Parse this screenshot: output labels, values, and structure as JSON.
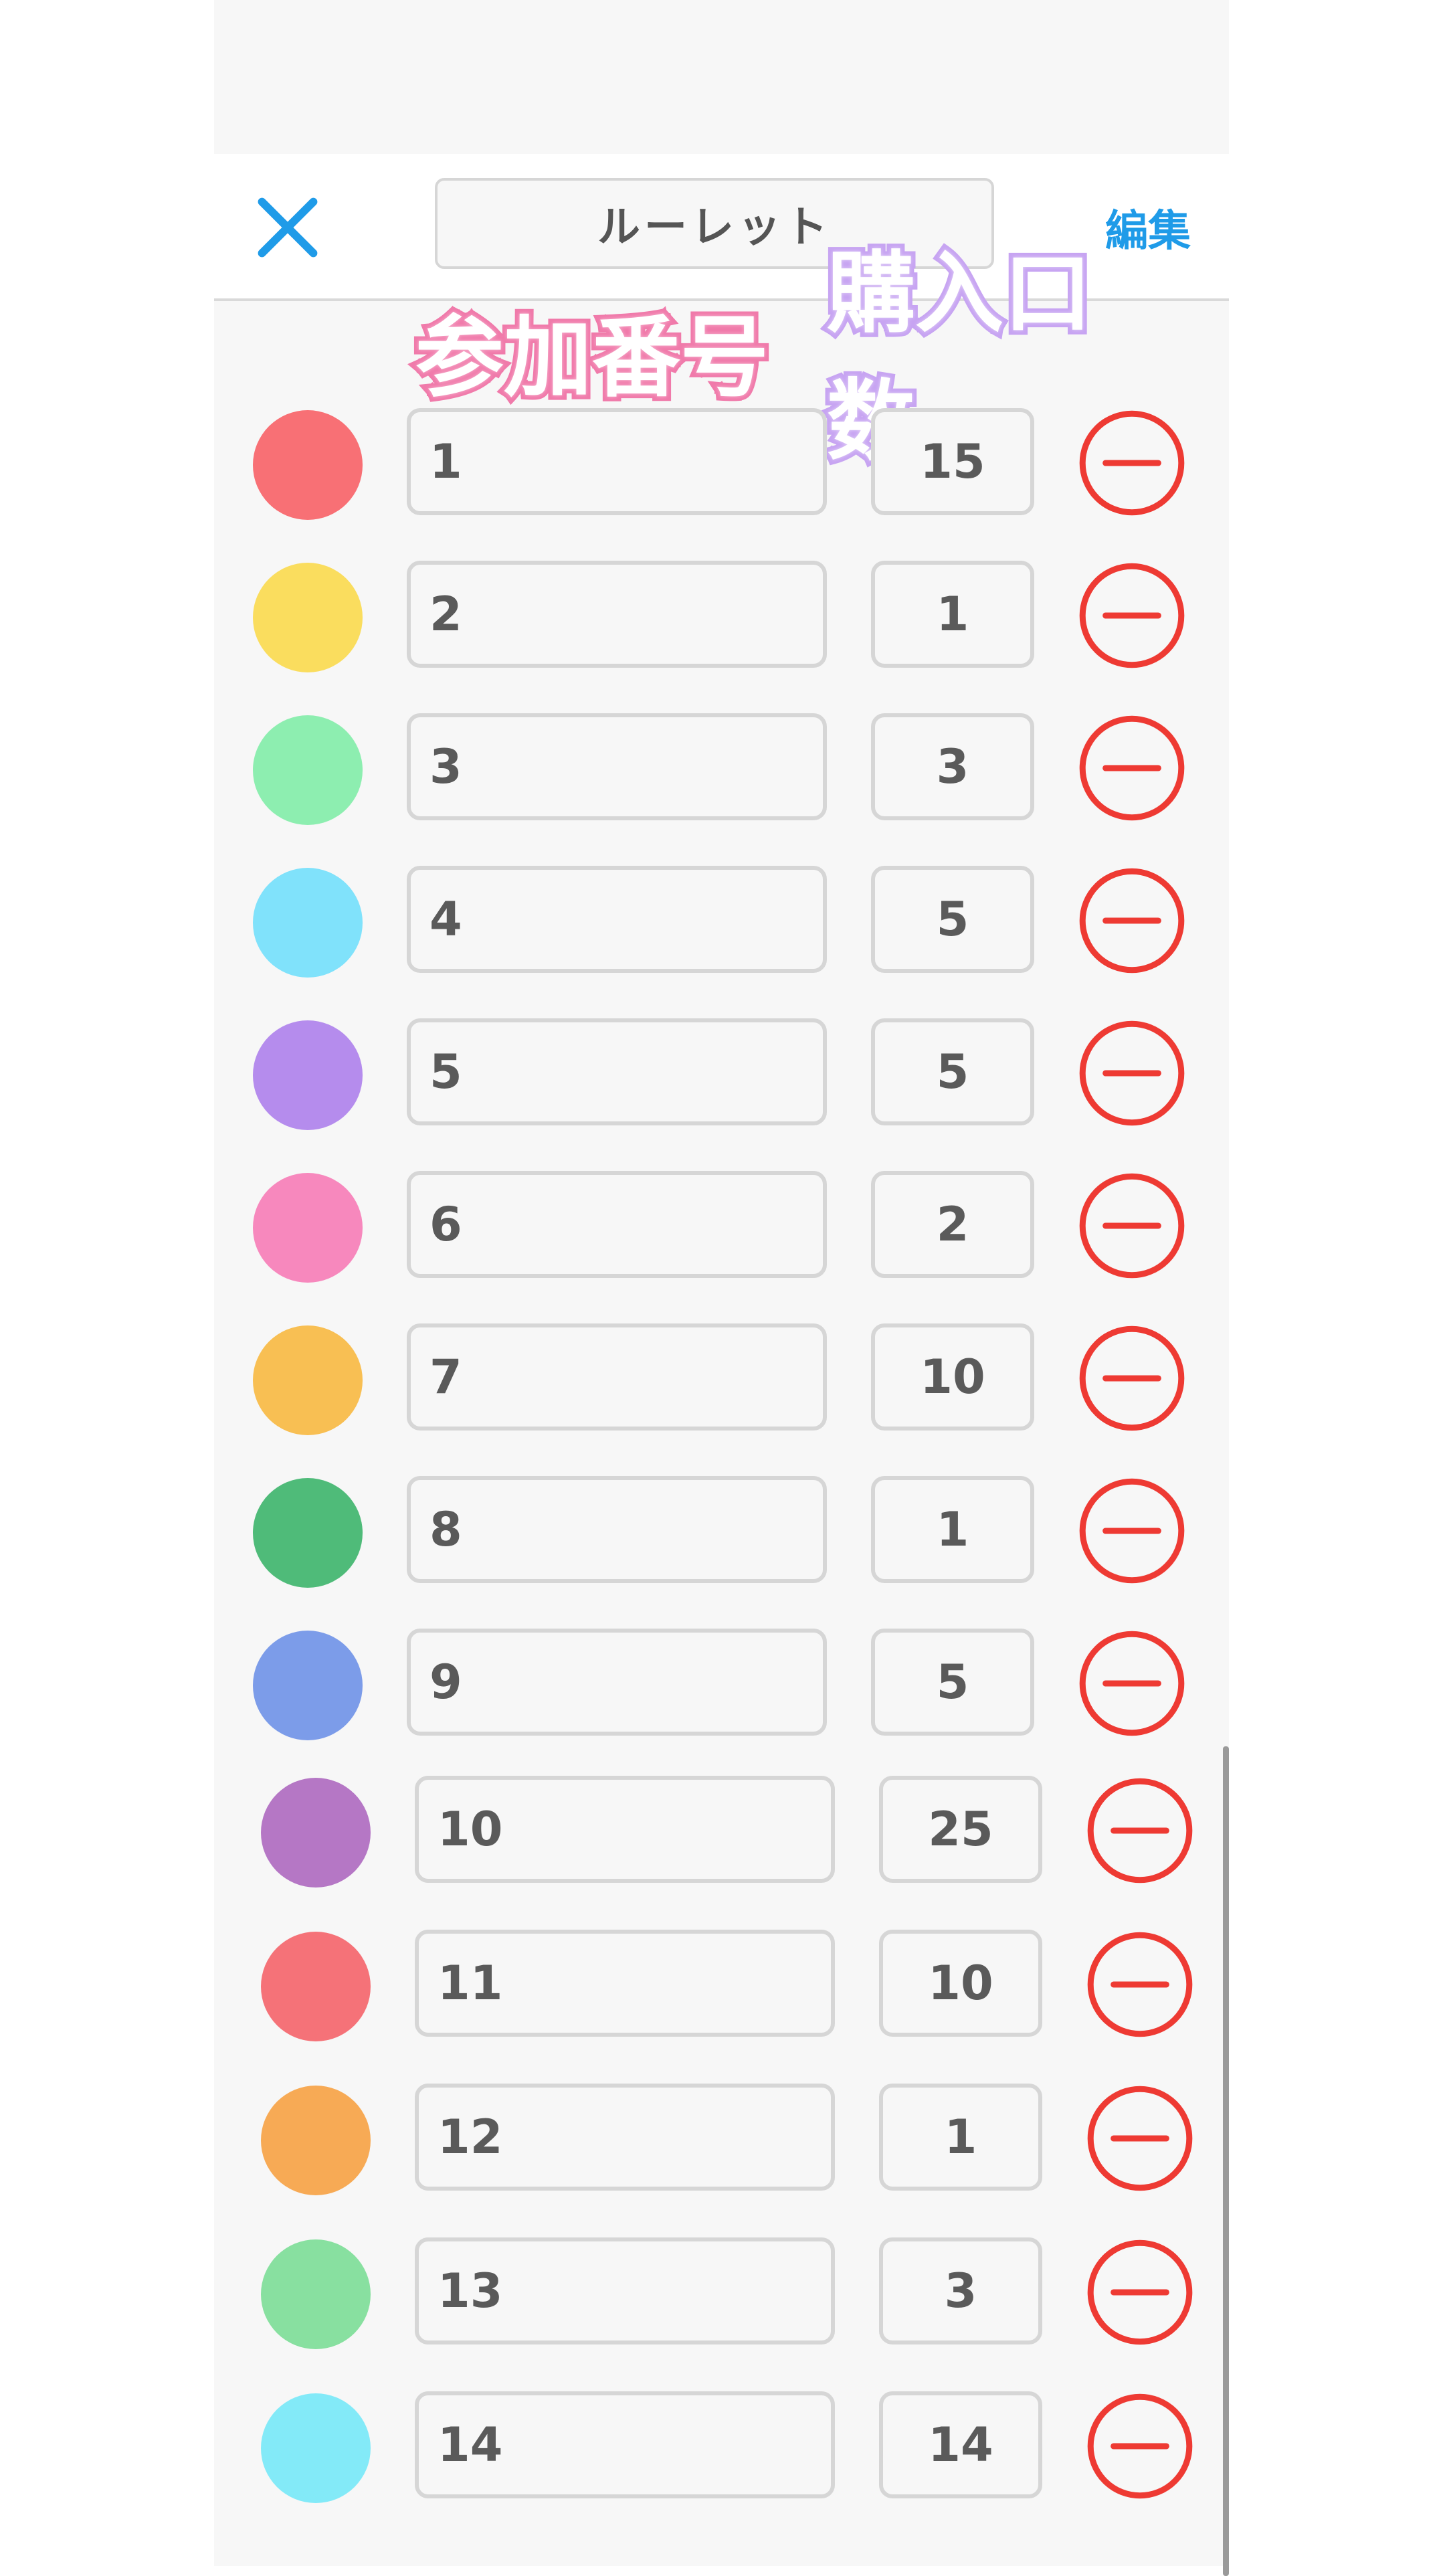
{
  "header": {
    "title": "ルーレット",
    "edit_label": "編集",
    "close_icon": "close-icon"
  },
  "columns": {
    "number_label": "参加番号",
    "count_label": "購入口数"
  },
  "colors": {
    "accent": "#1f9be8",
    "remove": "#ee3a33"
  },
  "rows": [
    {
      "number": "1",
      "count": "15",
      "color": "#f87075"
    },
    {
      "number": "2",
      "count": "1",
      "color": "#fadd5e"
    },
    {
      "number": "3",
      "count": "3",
      "color": "#8deeb0"
    },
    {
      "number": "4",
      "count": "5",
      "color": "#80e2fb"
    },
    {
      "number": "5",
      "count": "5",
      "color": "#b58ced"
    },
    {
      "number": "6",
      "count": "2",
      "color": "#f788bd"
    },
    {
      "number": "7",
      "count": "10",
      "color": "#f8bf53"
    },
    {
      "number": "8",
      "count": "1",
      "color": "#4fbb79"
    },
    {
      "number": "9",
      "count": "5",
      "color": "#7c9ce9"
    },
    {
      "number": "10",
      "count": "25",
      "color": "#b577c5"
    },
    {
      "number": "11",
      "count": "10",
      "color": "#f57278"
    },
    {
      "number": "12",
      "count": "1",
      "color": "#f7aa55"
    },
    {
      "number": "13",
      "count": "3",
      "color": "#88e0a0"
    },
    {
      "number": "14",
      "count": "14",
      "color": "#83eaf8"
    }
  ]
}
